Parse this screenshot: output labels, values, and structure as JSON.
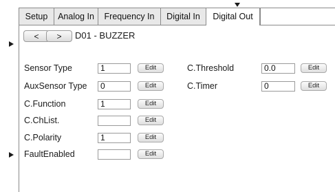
{
  "tabs": [
    "Setup",
    "Analog In",
    "Frequency In",
    "Digital In",
    "Digital Out"
  ],
  "active_tab": "Digital Out",
  "nav": {
    "prev_label": "<",
    "next_label": ">",
    "channel_title": "D01 - BUZZER"
  },
  "edit_label": "Edit",
  "left_fields": [
    {
      "label": "Sensor Type",
      "value": "1"
    },
    {
      "label": "AuxSensor Type",
      "value": "0"
    },
    {
      "label": "C.Function",
      "value": "1"
    },
    {
      "label": "C.ChList.",
      "value": ""
    },
    {
      "label": "C.Polarity",
      "value": "1"
    },
    {
      "label": "FaultEnabled",
      "value": ""
    }
  ],
  "right_fields": [
    {
      "label": "C.Threshold",
      "value": "0.0"
    },
    {
      "label": "C.Timer",
      "value": "0"
    }
  ]
}
